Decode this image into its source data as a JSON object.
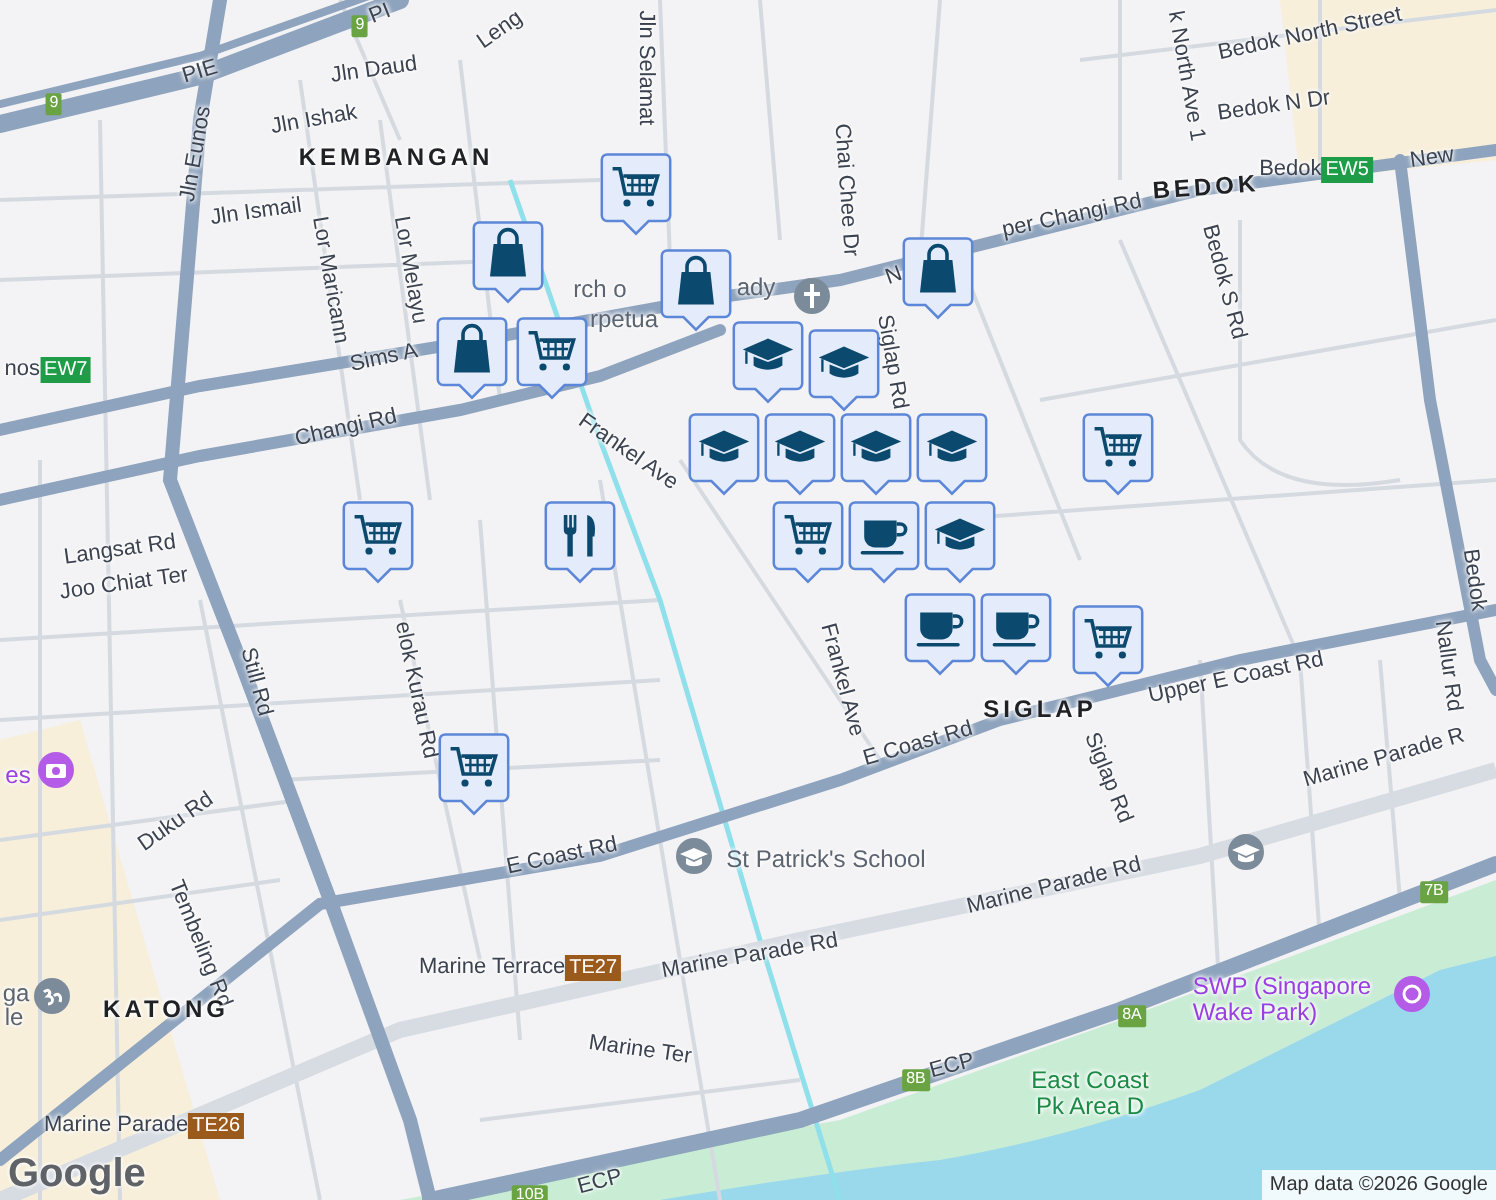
{
  "labels": [
    {
      "kind": "road",
      "text": "PI"
    },
    {
      "kind": "road",
      "text": "PIE"
    },
    {
      "kind": "road",
      "text": "Leng"
    },
    {
      "kind": "road",
      "text": "Jln Selamat"
    },
    {
      "kind": "road",
      "text": "Jln Daud"
    },
    {
      "kind": "road",
      "text": "Jln Ishak"
    },
    {
      "kind": "area",
      "text": "KEMBANGAN"
    },
    {
      "kind": "road",
      "text": "Jln Eunos"
    },
    {
      "kind": "road",
      "text": "Jln Ismail"
    },
    {
      "kind": "road",
      "text": "Lor Maricann"
    },
    {
      "kind": "road",
      "text": "Lor Melayu"
    },
    {
      "kind": "road",
      "text": "Chai Chee Dr"
    },
    {
      "kind": "road",
      "text": "Bedok North Street"
    },
    {
      "kind": "road",
      "text": "k North Ave 1"
    },
    {
      "kind": "road",
      "text": "Bedok N Dr"
    },
    {
      "kind": "area",
      "text": "BEDOK"
    },
    {
      "kind": "road",
      "text": "New"
    },
    {
      "kind": "road",
      "text": "N"
    },
    {
      "kind": "road",
      "text": "per Changi Rd"
    },
    {
      "kind": "road",
      "text": "Bedok S Rd"
    },
    {
      "kind": "place",
      "text": "rch o"
    },
    {
      "kind": "place",
      "text": "ady"
    },
    {
      "kind": "place",
      "text": "rpetua"
    },
    {
      "kind": "road",
      "text": "Siglap Rd"
    },
    {
      "kind": "road",
      "text": "Sims A"
    },
    {
      "kind": "road",
      "text": "Changi Rd"
    },
    {
      "kind": "road",
      "text": "Frankel Ave"
    },
    {
      "kind": "road",
      "text": "Langsat Rd"
    },
    {
      "kind": "road",
      "text": "Joo Chiat Ter"
    },
    {
      "kind": "road",
      "text": "Bedok"
    },
    {
      "kind": "road",
      "text": "Frankel Ave"
    },
    {
      "kind": "road",
      "text": "Still Rd"
    },
    {
      "kind": "road",
      "text": "elok Kurau Rd"
    },
    {
      "kind": "road",
      "text": "Upper E Coast Rd"
    },
    {
      "kind": "area",
      "text": "SIGLAP"
    },
    {
      "kind": "road",
      "text": "Nallur Rd"
    },
    {
      "kind": "road",
      "text": "E Coast Rd"
    },
    {
      "kind": "road",
      "text": "Siglap Rd"
    },
    {
      "kind": "attraction",
      "text": "es"
    },
    {
      "kind": "road",
      "text": "Duku Rd"
    },
    {
      "kind": "place",
      "text": "St Patrick's School"
    },
    {
      "kind": "road",
      "text": "E Coast Rd"
    },
    {
      "kind": "road",
      "text": "Marine Parade R"
    },
    {
      "kind": "road",
      "text": "Marine Parade Rd"
    },
    {
      "kind": "road",
      "text": "Tembeling Rd"
    },
    {
      "kind": "road",
      "text": "Marine Parade Rd"
    },
    {
      "kind": "place",
      "text": "ga"
    },
    {
      "kind": "place",
      "text": "le"
    },
    {
      "kind": "area",
      "text": "KATONG"
    },
    {
      "kind": "attraction",
      "text": "SWP (Singapore\nWake Park)"
    },
    {
      "kind": "road",
      "text": "Marine Ter"
    },
    {
      "kind": "road",
      "text": "ECP"
    },
    {
      "kind": "park",
      "text": "East Coast\nPk Area D"
    },
    {
      "kind": "road",
      "text": "ECP"
    },
    {
      "kind": "station",
      "text": "nos",
      "code": "EW7",
      "color": "#1e9c48"
    },
    {
      "kind": "station",
      "text": "Bedok",
      "code": "EW5",
      "color": "#1e9c48"
    },
    {
      "kind": "station",
      "text": "Marine Terrace",
      "code": "TE27",
      "color": "#9a5a1c"
    },
    {
      "kind": "station",
      "text": "Marine Parade",
      "code": "TE26",
      "color": "#9a5a1c"
    },
    {
      "kind": "route",
      "text": "9"
    },
    {
      "kind": "route",
      "text": "9"
    },
    {
      "kind": "route",
      "text": "7B"
    },
    {
      "kind": "route",
      "text": "8A"
    },
    {
      "kind": "route",
      "text": "8B"
    },
    {
      "kind": "route",
      "text": "10B"
    }
  ],
  "markers": [
    {
      "kind": "cart"
    },
    {
      "kind": "bag"
    },
    {
      "kind": "cart"
    },
    {
      "kind": "bag"
    },
    {
      "kind": "bag"
    },
    {
      "kind": "bag"
    },
    {
      "kind": "school"
    },
    {
      "kind": "school"
    },
    {
      "kind": "school"
    },
    {
      "kind": "school"
    },
    {
      "kind": "school"
    },
    {
      "kind": "school"
    },
    {
      "kind": "cart"
    },
    {
      "kind": "cup"
    },
    {
      "kind": "school"
    },
    {
      "kind": "cup"
    },
    {
      "kind": "cup"
    },
    {
      "kind": "cart"
    },
    {
      "kind": "cart"
    },
    {
      "kind": "cart"
    },
    {
      "kind": "cutlery"
    },
    {
      "kind": "cart"
    }
  ],
  "logo": "Google",
  "attribution": "Map data ©2026 Google"
}
